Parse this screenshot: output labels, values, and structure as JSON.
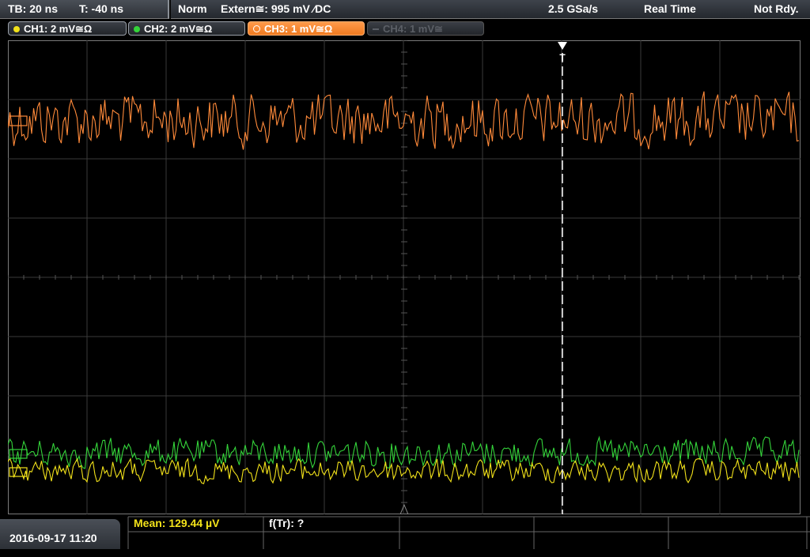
{
  "header": {
    "timebase": "TB: 20 ns",
    "trigger_time": "T: -40 ns",
    "mode": "Norm",
    "trigger_source": "Extern≅: 995 mV ⁄DC",
    "sample_rate": "2.5 GSa/s",
    "acquisition": "Real Time",
    "status": "Not Rdy."
  },
  "channels": [
    {
      "label": "CH1: 2 mV≅Ω",
      "color": "#f2e21a",
      "state": "on"
    },
    {
      "label": "CH2: 2 mV≅Ω",
      "color": "#34d43a",
      "state": "on"
    },
    {
      "label": "CH3: 1 mV≅Ω",
      "color": "#ff8a3a",
      "state": "selected"
    },
    {
      "label": "CH4: 1 mV≅",
      "color": "#5b5f66",
      "state": "off"
    }
  ],
  "trigger_marker": "T",
  "footer": {
    "datetime": "2016-09-17 11:20",
    "mean": "Mean: 129.44 µV",
    "frequency": "f(Tr): ?"
  },
  "colors": {
    "grid": "#3a3a3a",
    "ch1": "#f2e21a",
    "ch2": "#34d43a",
    "ch3": "#ff8a3a",
    "trigger_line": "#ffffff"
  }
}
